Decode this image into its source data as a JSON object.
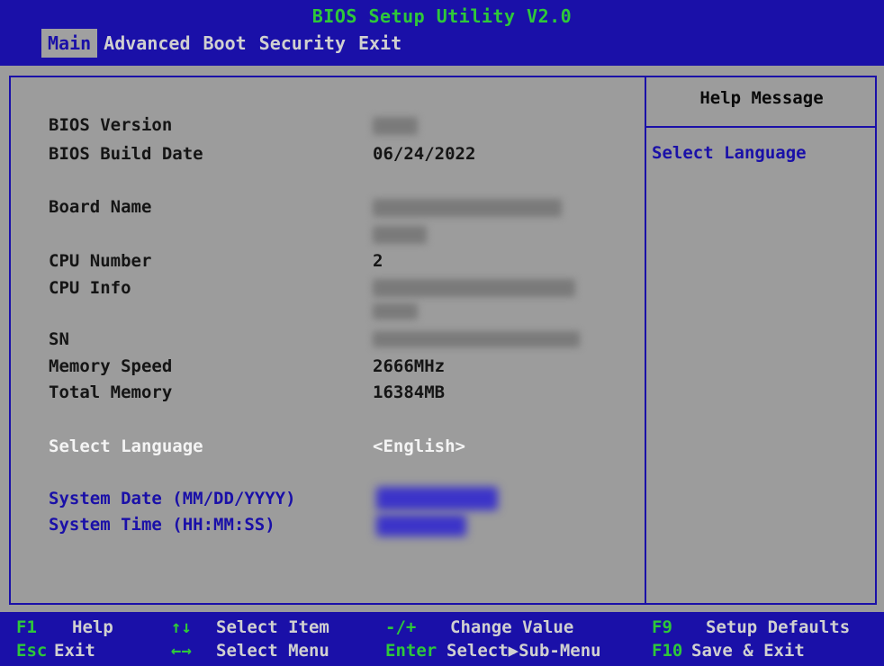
{
  "header": {
    "title": "BIOS Setup Utility V2.0",
    "menu": [
      "Main",
      "Advanced",
      "Boot",
      "Security",
      "Exit"
    ],
    "active_menu": "Main"
  },
  "main": {
    "bios_version_label": "BIOS Version",
    "bios_build_date_label": "BIOS Build Date",
    "bios_build_date_value": "06/24/2022",
    "board_name_label": "Board Name",
    "cpu_number_label": "CPU Number",
    "cpu_number_value": "2",
    "cpu_info_label": "CPU Info",
    "sn_label": "SN",
    "memory_speed_label": "Memory Speed",
    "memory_speed_value": "2666MHz",
    "total_memory_label": "Total Memory",
    "total_memory_value": "16384MB",
    "select_language_label": "Select Language",
    "select_language_value": "<English>",
    "system_date_label": "System Date (MM/DD/YYYY)",
    "system_time_label": "System Time (HH:MM:SS)"
  },
  "help": {
    "title": "Help Message",
    "text": "Select Language"
  },
  "footer": {
    "items": [
      {
        "key": "F1",
        "desc": "Help"
      },
      {
        "key": "Esc",
        "desc": "Exit"
      },
      {
        "key": "↑↓",
        "desc": "Select Item"
      },
      {
        "key": "←→",
        "desc": "Select Menu"
      },
      {
        "key": "-/+",
        "desc": "Change Value"
      },
      {
        "key": "Enter",
        "desc": "Select▶Sub-Menu"
      },
      {
        "key": "F9",
        "desc": "Setup Defaults"
      },
      {
        "key": "F10",
        "desc": "Save & Exit"
      }
    ]
  },
  "colors": {
    "background": "#9c9c9c",
    "bar_blue": "#1a10a8",
    "title_green": "#2ec83a",
    "selected_white": "#f4f4f4"
  }
}
